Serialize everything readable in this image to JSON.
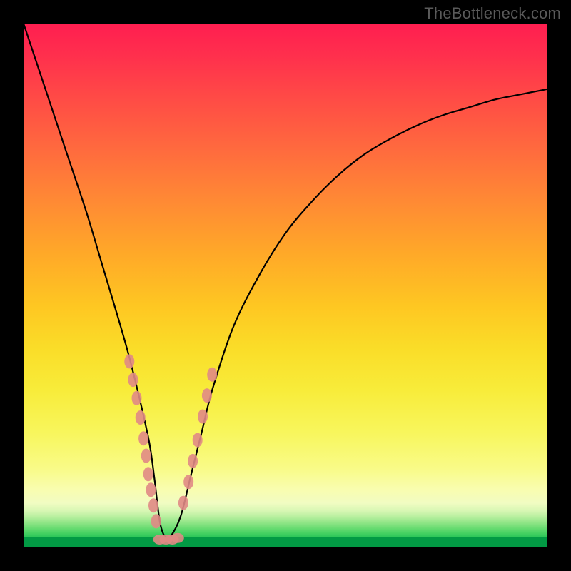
{
  "watermark": "TheBottleneck.com",
  "chart_data": {
    "type": "line",
    "title": "",
    "xlabel": "",
    "ylabel": "",
    "xlim": [
      0,
      100
    ],
    "ylim": [
      0,
      100
    ],
    "grid": false,
    "legend": false,
    "curve": {
      "name": "bottleneck-curve",
      "x": [
        0,
        4,
        8,
        12,
        15,
        18,
        20,
        22,
        24,
        25,
        26,
        27,
        28,
        30,
        32,
        34,
        36,
        40,
        45,
        50,
        55,
        60,
        65,
        70,
        75,
        80,
        85,
        90,
        95,
        100
      ],
      "y": [
        100,
        88,
        76,
        64,
        54,
        44,
        37,
        29,
        20,
        13,
        5,
        2,
        2,
        6,
        14,
        22,
        30,
        42,
        52,
        60,
        66,
        71,
        75,
        78,
        80.5,
        82.5,
        84,
        85.5,
        86.5,
        87.5
      ]
    },
    "markers_left": {
      "x": [
        20.2,
        20.9,
        21.6,
        22.3,
        22.9,
        23.4,
        23.8,
        24.3,
        24.8,
        25.3
      ],
      "y": [
        35.5,
        32.0,
        28.5,
        24.8,
        20.8,
        17.5,
        14.0,
        11.0,
        8.0,
        5.0
      ]
    },
    "markers_right": {
      "x": [
        30.5,
        31.5,
        32.3,
        33.2,
        34.2,
        35.0,
        36.0
      ],
      "y": [
        8.5,
        12.5,
        16.5,
        20.5,
        25.0,
        29.0,
        33.0
      ]
    },
    "markers_bottom": {
      "x": [
        26.0,
        27.2,
        28.4,
        29.4
      ],
      "y": [
        1.5,
        1.5,
        1.5,
        1.8
      ]
    },
    "gradient_stops_pct": [
      0,
      6,
      14,
      24,
      34,
      44,
      54,
      62,
      70,
      78,
      85,
      89,
      91.5,
      93,
      94.2,
      95.3,
      96.3,
      97.2,
      98,
      98.7,
      99.3,
      100
    ],
    "gradient_colors": [
      "#ff1e50",
      "#ff2f4d",
      "#ff4a46",
      "#ff6a3e",
      "#ff8a34",
      "#ffa928",
      "#fec722",
      "#fadd28",
      "#f8ec3a",
      "#f8f65c",
      "#f9fb88",
      "#f9fdb0",
      "#f1fcc2",
      "#d8f7b4",
      "#b6ef9e",
      "#8fe586",
      "#6adc72",
      "#48d263",
      "#2cc659",
      "#15b851",
      "#07a84a",
      "#029a44"
    ]
  }
}
